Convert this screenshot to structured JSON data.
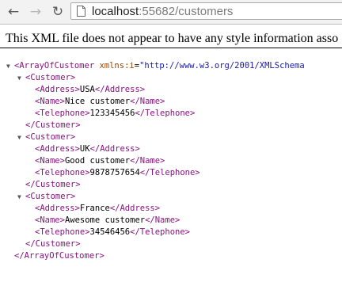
{
  "browser": {
    "url_host": "localhost",
    "url_rest": ":55682/customers",
    "nav_icons": [
      "back-arrow-icon",
      "forward-arrow-icon",
      "reload-icon",
      "page-icon"
    ]
  },
  "info_bar": {
    "text": "This XML file does not appear to have any style information asso"
  },
  "xml": {
    "root_tag": "ArrayOfCustomer",
    "root_attr_name": "xmlns:i",
    "root_attr_value": "\"http://www.w3.org/2001/XMLSchema",
    "customer_tag": "Customer",
    "fields": [
      "Address",
      "Name",
      "Telephone"
    ],
    "customers": [
      {
        "Address": "USA",
        "Name": "Nice customer",
        "Telephone": "123345456"
      },
      {
        "Address": "UK",
        "Name": "Good customer",
        "Telephone": "9878757654"
      },
      {
        "Address": "France",
        "Name": "Awesome customer",
        "Telephone": "34546456"
      }
    ]
  },
  "colors": {
    "tag": "#881280",
    "attr_name": "#994500",
    "attr_value": "#1a1aa6"
  }
}
